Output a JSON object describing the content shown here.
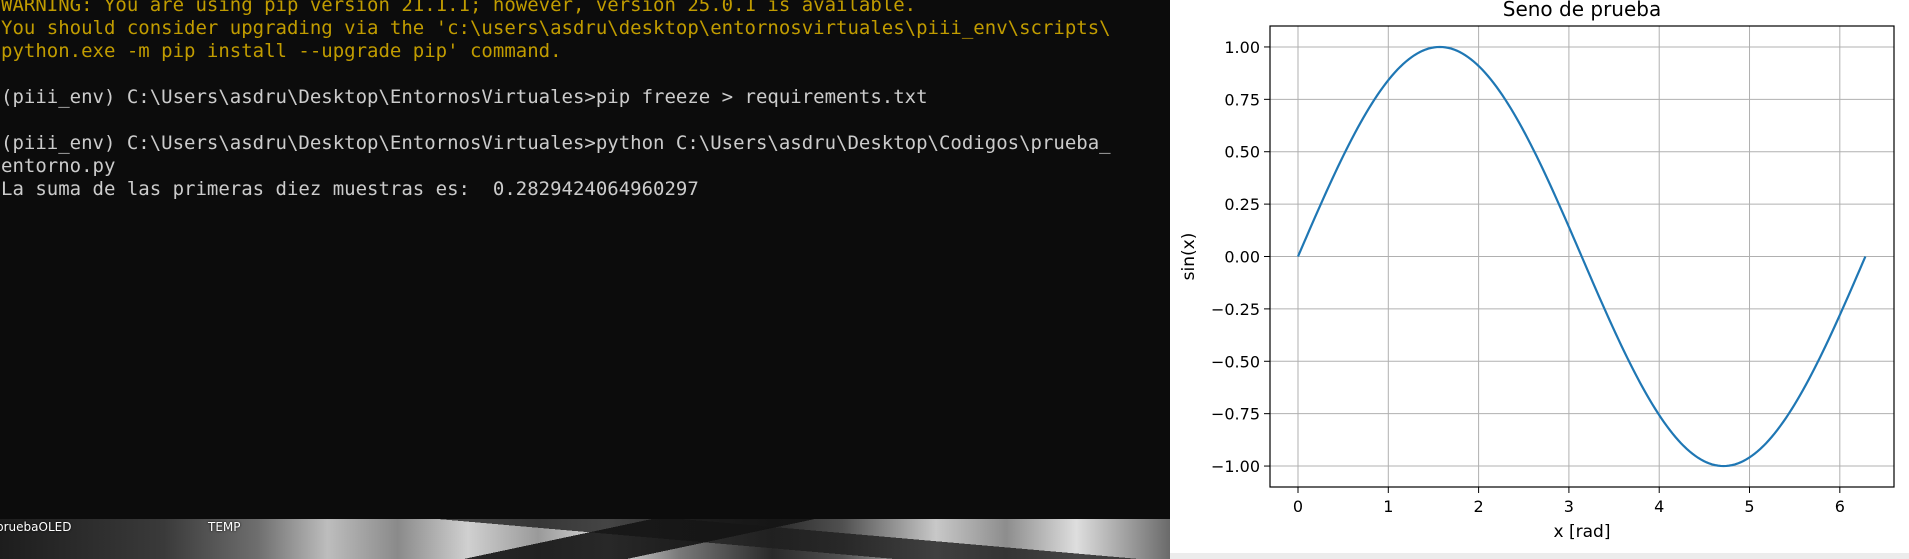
{
  "terminal": {
    "lines": [
      {
        "text": "WARNING: You are using pip version 21.1.1; however, version 25.0.1 is available.",
        "kind": "warning"
      },
      {
        "text": "You should consider upgrading via the 'c:\\users\\asdru\\desktop\\entornosvirtuales\\piii_env\\scripts\\",
        "kind": "warning"
      },
      {
        "text": "python.exe -m pip install --upgrade pip' command.",
        "kind": "warning"
      },
      {
        "text": "",
        "kind": "normal"
      },
      {
        "text": "(piii_env) C:\\Users\\asdru\\Desktop\\EntornosVirtuales>pip freeze > requirements.txt",
        "kind": "normal"
      },
      {
        "text": "",
        "kind": "normal"
      },
      {
        "text": "(piii_env) C:\\Users\\asdru\\Desktop\\EntornosVirtuales>python C:\\Users\\asdru\\Desktop\\Codigos\\prueba_",
        "kind": "normal"
      },
      {
        "text": "entorno.py",
        "kind": "normal"
      },
      {
        "text": "La suma de las primeras diez muestras es:  0.2829424064960297",
        "kind": "normal"
      }
    ],
    "colors": {
      "background": "#0c0c0c",
      "text": "#cccccc",
      "warning": "#c19c00"
    }
  },
  "desktop": {
    "icon_labels": [
      "pruebaOLED",
      "TEMP"
    ]
  },
  "chart_data": {
    "type": "line",
    "title": "Seno de prueba",
    "xlabel": "x [rad]",
    "ylabel": "sin(x)",
    "xlim": [
      -0.31,
      6.6
    ],
    "ylim": [
      -1.1,
      1.1
    ],
    "xticks": [
      0,
      1,
      2,
      3,
      4,
      5,
      6
    ],
    "yticks": [
      1.0,
      0.75,
      0.5,
      0.25,
      0.0,
      -0.25,
      -0.5,
      -0.75,
      -1.0
    ],
    "ytick_labels": [
      "1.00",
      "0.75",
      "0.50",
      "0.25",
      "0.00",
      "−0.25",
      "−0.50",
      "−0.75",
      "−1.00"
    ],
    "grid": true,
    "series": [
      {
        "function": "sin",
        "x_start": 0,
        "x_end": 6.2832,
        "color": "#1f77b4"
      }
    ]
  }
}
